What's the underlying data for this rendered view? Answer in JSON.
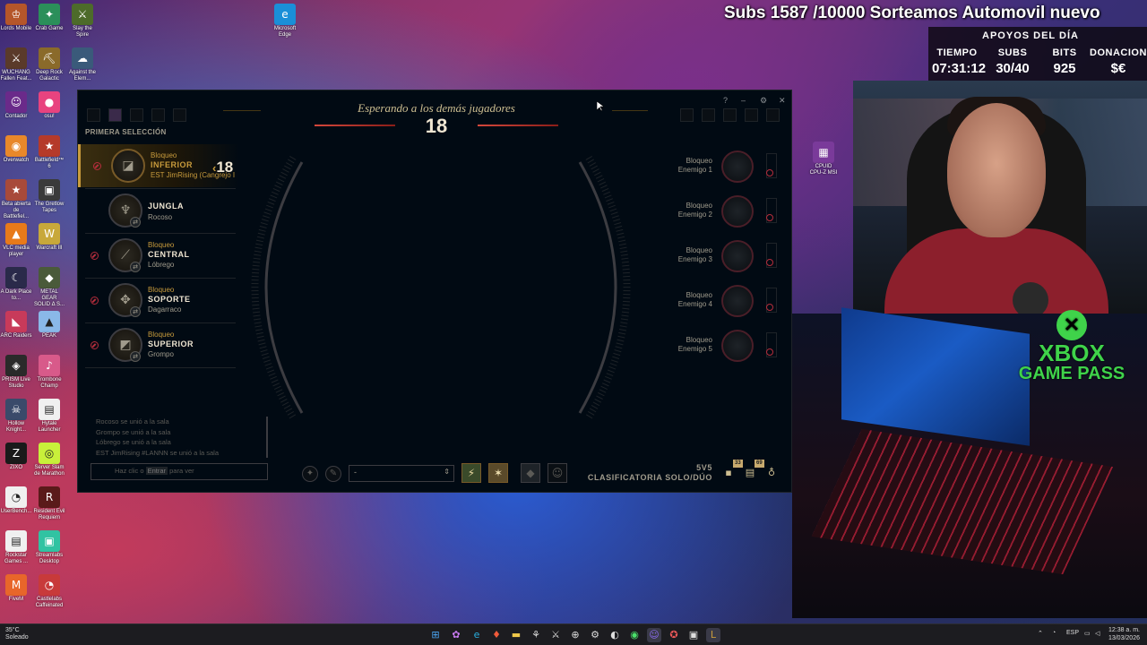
{
  "stream": {
    "banner": "Subs 1587 /10000 Sorteamos Automovil nuevo",
    "stats_title": "APOYOS DEL DÍA",
    "stats": [
      {
        "header": "TIEMPO",
        "value": "07:31:12"
      },
      {
        "header": "SUBS",
        "value": "30/40"
      },
      {
        "header": "BITS",
        "value": "925"
      },
      {
        "header": "DONACIONES",
        "value": "$€"
      }
    ],
    "xbox_line1": "XBOX",
    "xbox_line2": "GAME PASS"
  },
  "desktop_icons": [
    {
      "label": "Lords Mobile",
      "color": "#b5562a",
      "glyph": "♔"
    },
    {
      "label": "Crab Game",
      "color": "#2b8f5a",
      "glyph": "✦"
    },
    {
      "label": "Slay the Spire",
      "color": "#4d6b2a",
      "glyph": "⚔"
    },
    {
      "label": "Microsoft Edge",
      "color": "#1a8fd8",
      "glyph": "e"
    },
    {
      "label": "WUCHANG Fallen Feat...",
      "color": "#5a3a2a",
      "glyph": "⚔"
    },
    {
      "label": "Deep Rock Galactic",
      "color": "#8a6a2a",
      "glyph": "⛏"
    },
    {
      "label": "Against the Elem...",
      "color": "#3a5a7a",
      "glyph": "☁"
    },
    {
      "label": "Contador",
      "color": "#6a2a8a",
      "glyph": "☺"
    },
    {
      "label": "osu!",
      "color": "#e8437f",
      "glyph": "●"
    },
    {
      "label": "Overwatch",
      "color": "#e8882a",
      "glyph": "◉"
    },
    {
      "label": "Battlefield™ 6",
      "color": "#b53a2a",
      "glyph": "★"
    },
    {
      "label": "Beta abierta de Battlefiel...",
      "color": "#a84a3a",
      "glyph": "★"
    },
    {
      "label": "The Gretlow Tapes",
      "color": "#3a3a3a",
      "glyph": "▣"
    },
    {
      "label": "VLC media player",
      "color": "#e87a1a",
      "glyph": "▲"
    },
    {
      "label": "Warcraft III",
      "color": "#c8a83a",
      "glyph": "W"
    },
    {
      "label": "A Dark Place to...",
      "color": "#2a2a4a",
      "glyph": "☾"
    },
    {
      "label": "METAL GEAR SOLID Δ S...",
      "color": "#4a5a3a",
      "glyph": "◆"
    },
    {
      "label": "ARC Raiders",
      "color": "#c83a5a",
      "glyph": "◣"
    },
    {
      "label": "PEAK",
      "color": "#8ab8e8",
      "glyph": "▲"
    },
    {
      "label": "PRISM Live Studio",
      "color": "#2a2a2a",
      "glyph": "◈"
    },
    {
      "label": "Trombone Champ",
      "color": "#d85a8a",
      "glyph": "♪"
    },
    {
      "label": "Hollow Knight...",
      "color": "#3a4a6a",
      "glyph": "☠"
    },
    {
      "label": "Hytale Launcher",
      "color": "#f0f0f0",
      "glyph": "▤"
    },
    {
      "label": "ZIXO",
      "color": "#1a1a1a",
      "glyph": "Z"
    },
    {
      "label": "Server Slam de Marathon",
      "color": "#c8f03a",
      "glyph": "◎"
    },
    {
      "label": "UserBench...",
      "color": "#f0f0f0",
      "glyph": "◔"
    },
    {
      "label": "Resident Evil Requiem",
      "color": "#5a1a1a",
      "glyph": "R"
    },
    {
      "label": "Rockstar Games ...",
      "color": "#f0f0f0",
      "glyph": "▤"
    },
    {
      "label": "Streamlabs Desktop",
      "color": "#31c3a2",
      "glyph": "▣"
    },
    {
      "label": "FiveM",
      "color": "#e8662a",
      "glyph": "M"
    },
    {
      "label": "Castlelabs Caffeinated",
      "color": "#c83a3a",
      "glyph": "◔"
    }
  ],
  "cpu_icon_label": "CPUID CPU-Z MSI",
  "client": {
    "header_title": "Esperando a los demás jugadores",
    "header_timer": "18",
    "section_title": "PRIMERA SELECCIÓN",
    "pick_timer": "18",
    "allies": [
      {
        "line1": "Bloqueo",
        "line2": "INFERIOR",
        "line3": "EST JimRising (Cangrejo I",
        "glyph": "◪",
        "active": true,
        "ban": true
      },
      {
        "line1": "",
        "line2": "JUNGLA",
        "line3": "Rocoso",
        "glyph": "♆",
        "active": false,
        "ban": false
      },
      {
        "line1": "Bloqueo",
        "line2": "CENTRAL",
        "line3": "Lóbrego",
        "glyph": "⟋",
        "active": false,
        "ban": true
      },
      {
        "line1": "Bloqueo",
        "line2": "SOPORTE",
        "line3": "Dagarraco",
        "glyph": "✥",
        "active": false,
        "ban": true
      },
      {
        "line1": "Bloqueo",
        "line2": "SUPERIOR",
        "line3": "Grompo",
        "glyph": "◩",
        "active": false,
        "ban": true
      }
    ],
    "enemies": [
      {
        "line1": "Bloqueo",
        "line2": "Enemigo 1"
      },
      {
        "line1": "Bloqueo",
        "line2": "Enemigo 2"
      },
      {
        "line1": "Bloqueo",
        "line2": "Enemigo 3"
      },
      {
        "line1": "Bloqueo",
        "line2": "Enemigo 4"
      },
      {
        "line1": "Bloqueo",
        "line2": "Enemigo 5"
      }
    ],
    "chat_log": [
      "Rocoso se unió a la sala",
      "Grompo se unió a la sala",
      "Lóbrego se unió a la sala",
      "EST JimRising #LANNN se unió a la sala"
    ],
    "chat_placeholder_pre": "Haz clic o",
    "chat_placeholder_key": "Entrar",
    "chat_placeholder_post": "para ver",
    "skin_select_value": "-",
    "queue_format": "5V5",
    "queue_name": "CLASIFICATORIA SOLO/DÚO",
    "badge_1": "33",
    "badge_2": "69",
    "window_controls": [
      "?",
      "–",
      "⚙",
      "✕"
    ]
  },
  "taskbar": {
    "weather_temp": "35°C",
    "weather_text": "Soleado",
    "lang": "ESP",
    "time": "12:38 a. m.",
    "date": "13/03/2026"
  },
  "colors": {
    "gold": "#c89b3c",
    "light_gold": "#f0e6d2",
    "client_bg": "#010a13",
    "red_ban": "#b52d3c",
    "timer_bar": "#d4473b"
  }
}
